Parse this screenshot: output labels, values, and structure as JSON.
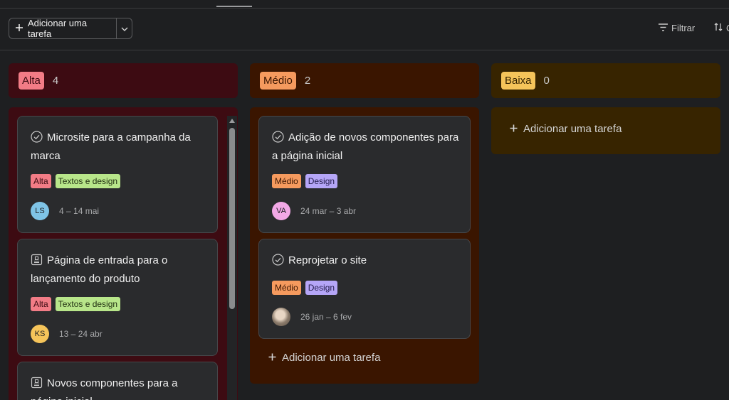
{
  "toolbar": {
    "add_task_label": "Adicionar uma tarefa",
    "filter_label": "Filtrar",
    "sort_label": "C"
  },
  "columns": [
    {
      "name": "Alta",
      "count": "4",
      "cards": [
        {
          "title": "Microsite para a campanha da marca",
          "icon": "check-circle-icon",
          "tags": [
            "Alta",
            "Textos e design"
          ],
          "avatar": "LS",
          "dates": "4 – 14 mai"
        },
        {
          "title": "Página de entrada para o lançamento do produto",
          "icon": "approval-stamp-icon",
          "tags": [
            "Alta",
            "Textos e design"
          ],
          "avatar": "KS",
          "dates": "13 – 24 abr"
        },
        {
          "title": "Novos componentes para a página inicial",
          "icon": "approval-stamp-icon"
        }
      ]
    },
    {
      "name": "Médio",
      "count": "2",
      "cards": [
        {
          "title": "Adição de novos componentes para a página inicial",
          "icon": "check-circle-icon",
          "tags": [
            "Médio",
            "Design"
          ],
          "avatar": "VA",
          "dates": "24 mar – 3 abr"
        },
        {
          "title": "Reprojetar o site",
          "icon": "check-circle-icon",
          "tags": [
            "Médio",
            "Design"
          ],
          "avatar": "",
          "dates": "26 jan – 6 fev"
        }
      ],
      "add_label": "Adicionar uma tarefa"
    },
    {
      "name": "Baixa",
      "count": "0",
      "add_label": "Adicionar uma tarefa"
    }
  ],
  "colors": {
    "alta_bg": "#3d0b12",
    "alta_tag": "#f27c86",
    "medio_bg": "#3a1500",
    "medio_tag": "#f59a5e",
    "baixa_bg": "#372400",
    "baixa_tag": "#f5c45a",
    "textos_tag": "#b8e68a",
    "design_tag": "#b5a6f7"
  }
}
